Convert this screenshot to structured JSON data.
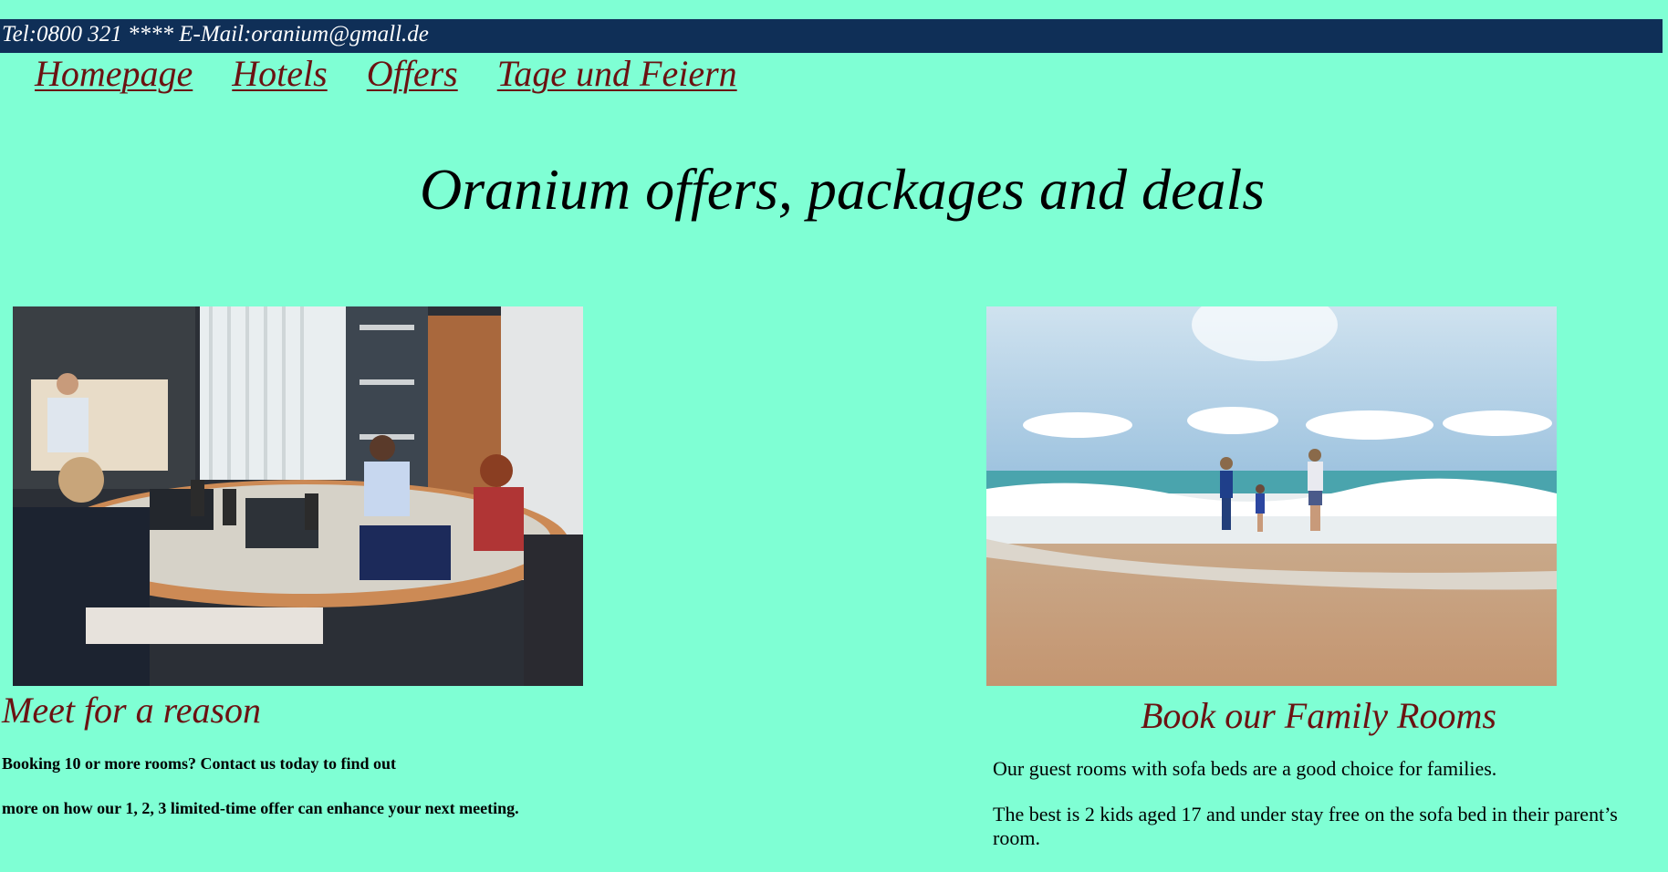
{
  "contact_bar": {
    "text": "Tel:0800 321 **** E-Mail:oranium@gmall.de"
  },
  "nav": {
    "items": [
      {
        "label": "Homepage"
      },
      {
        "label": "Hotels"
      },
      {
        "label": "Offers"
      },
      {
        "label": "Tage und Feiern"
      }
    ]
  },
  "page": {
    "title": "Oranium offers, packages and deals"
  },
  "meeting_card": {
    "heading": "Meet for a reason",
    "paragraphs": [
      "Booking 10 or more rooms? Contact us today to find out",
      "more on how our 1, 2, 3 limited-time offer can enhance your next meeting."
    ]
  },
  "family_card": {
    "heading": "Book our Family Rooms",
    "paragraphs": [
      "Our guest rooms with sofa beds are a good choice for families.",
      "The best is 2 kids aged 17 and under stay free on the sofa bed in their parent’s room."
    ]
  },
  "colors": {
    "background": "#7fffd4",
    "contact_bar": "#0f2f57",
    "accent_text": "#6b1212"
  }
}
